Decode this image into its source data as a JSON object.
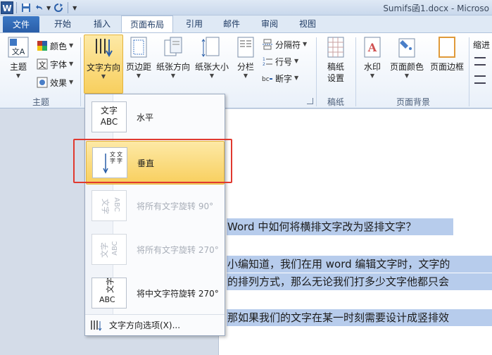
{
  "title_bar": {
    "app_icon": "W",
    "doc_title": "Sumifs函1.docx - Microso"
  },
  "tabs": [
    {
      "label": "文件"
    },
    {
      "label": "开始"
    },
    {
      "label": "插入"
    },
    {
      "label": "页面布局"
    },
    {
      "label": "引用"
    },
    {
      "label": "邮件"
    },
    {
      "label": "审阅"
    },
    {
      "label": "视图"
    }
  ],
  "active_tab": "页面布局",
  "ribbon": {
    "theme": {
      "label": "主题",
      "colors": "颜色",
      "fonts": "字体",
      "effects": "效果",
      "group": "主题"
    },
    "page_setup": {
      "text_direction": "文字方向",
      "margins": "页边距",
      "orientation": "纸张方向",
      "size": "纸张大小",
      "columns": "分栏",
      "breaks": "分隔符",
      "line_numbers": "行号",
      "hyphenation": "断字"
    },
    "manuscript": {
      "label_line1": "稿纸",
      "label_line2": "设置",
      "group": "稿纸"
    },
    "background": {
      "watermark": "水印",
      "page_color": "页面颜色",
      "page_borders": "页面边框",
      "group": "页面背景"
    },
    "cut_label": "缩进"
  },
  "dropdown": {
    "items": [
      {
        "label": "水平",
        "icon_text": "文字\nABC",
        "enabled": true
      },
      {
        "label": "垂直",
        "enabled": true,
        "highlighted": true
      },
      {
        "label": "将所有文字旋转 90°",
        "enabled": false
      },
      {
        "label": "将所有文字旋转 270°",
        "enabled": false
      },
      {
        "label": "将中文字符旋转 270°",
        "enabled": true
      }
    ],
    "footer": "文字方向选项(X)..."
  },
  "icon_text": {
    "horizontal_top": "文字",
    "horizontal_bottom": "ABC",
    "cjk_a": "文",
    "cjk_b": "字",
    "latin": "ABC"
  },
  "document": {
    "lines": [
      "Word 中如何将横排文字改为竖排文字？",
      "小编知道，我们在用 word 编辑文字时，文字的",
      "的排列方式，那么无论我们打多少文字他都只会",
      "那如果我们的文字在某一时刻需要设计成竖排效"
    ]
  },
  "colors": {
    "accent": "#2b5797",
    "highlight": "#f8cf5e",
    "selection": "#b7ccec",
    "callout": "#e0392f"
  }
}
